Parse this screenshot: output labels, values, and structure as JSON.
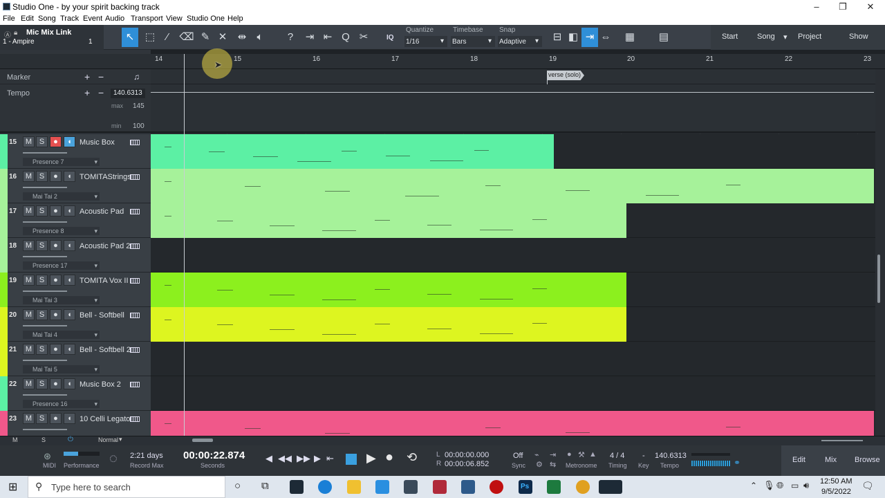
{
  "window": {
    "title": "Studio One - by your spirit backing track"
  },
  "menu": [
    "File",
    "Edit",
    "Song",
    "Track",
    "Event",
    "Audio",
    "Transport",
    "View",
    "Studio One",
    "Help"
  ],
  "toolbar": {
    "device": "Mic Mix Link",
    "device_sub": "1 - Ampire",
    "device_num": "1",
    "quantize_label": "Quantize",
    "quantize_value": "1/16",
    "timebase_label": "Timebase",
    "timebase_value": "Bars",
    "snap_label": "Snap",
    "snap_value": "Adaptive",
    "iq": "IQ",
    "views": [
      "Start",
      "Song",
      "Project",
      "Show"
    ]
  },
  "ruler": {
    "ticks": [
      "14",
      "15",
      "16",
      "17",
      "18",
      "19",
      "20",
      "21",
      "22",
      "23"
    ]
  },
  "marker_track": {
    "label": "Marker",
    "marker_text": "verse (solo)"
  },
  "tempo_track": {
    "label": "Tempo",
    "value": "140.6313",
    "max_label": "max",
    "max": "145",
    "min_label": "min",
    "min": "100"
  },
  "tracks": [
    {
      "num": "15",
      "name": "Music Box",
      "inst": "Presence 7",
      "color": "#5cf0a4"
    },
    {
      "num": "16",
      "name": "TOMITAStrings",
      "inst": "Mai Tai 2",
      "color": "#a6f29a"
    },
    {
      "num": "17",
      "name": "Acoustic Pad",
      "inst": "Presence 8",
      "color": "#a6f29a"
    },
    {
      "num": "18",
      "name": "Acoustic Pad 2",
      "inst": "Presence 17",
      "color": "#a6f29a"
    },
    {
      "num": "19",
      "name": "TOMITA Vox II",
      "inst": "Mai Tai 3",
      "color": "#8cf01e"
    },
    {
      "num": "20",
      "name": "Bell - Softbell",
      "inst": "Mai Tai 4",
      "color": "#ddf520"
    },
    {
      "num": "21",
      "name": "Bell - Softbell 2",
      "inst": "Mai Tai 5",
      "color": "#ddf520"
    },
    {
      "num": "22",
      "name": "Music Box 2",
      "inst": "Presence 16",
      "color": "#5cf0a4"
    },
    {
      "num": "23",
      "name": "10 Celli Legato",
      "inst": "",
      "color": "#f0588a"
    }
  ],
  "track_buttons": {
    "mute": "M",
    "solo": "S"
  },
  "bottom": {
    "m": "M",
    "s": "S",
    "mode": "Normal"
  },
  "transport": {
    "midi_label": "MIDI",
    "perf_label": "Performance",
    "record_max": "2:21 days",
    "record_max_label": "Record Max",
    "time": "00:00:22.874",
    "time_label": "Seconds",
    "loop_l_label": "L",
    "loop_l": "00:00:00.000",
    "loop_r_label": "R",
    "loop_r": "00:00:06.852",
    "sync_value": "Off",
    "sync_label": "Sync",
    "metronome_label": "Metronome",
    "timing_value": "4 / 4",
    "timing_label": "Timing",
    "key_value": "-",
    "key_label": "Key",
    "tempo_value": "140.6313",
    "tempo_label": "Tempo",
    "views": [
      "Edit",
      "Mix",
      "Browse"
    ]
  },
  "taskbar": {
    "search_placeholder": "Type here to search",
    "time": "12:50 AM",
    "date": "9/5/2022"
  }
}
